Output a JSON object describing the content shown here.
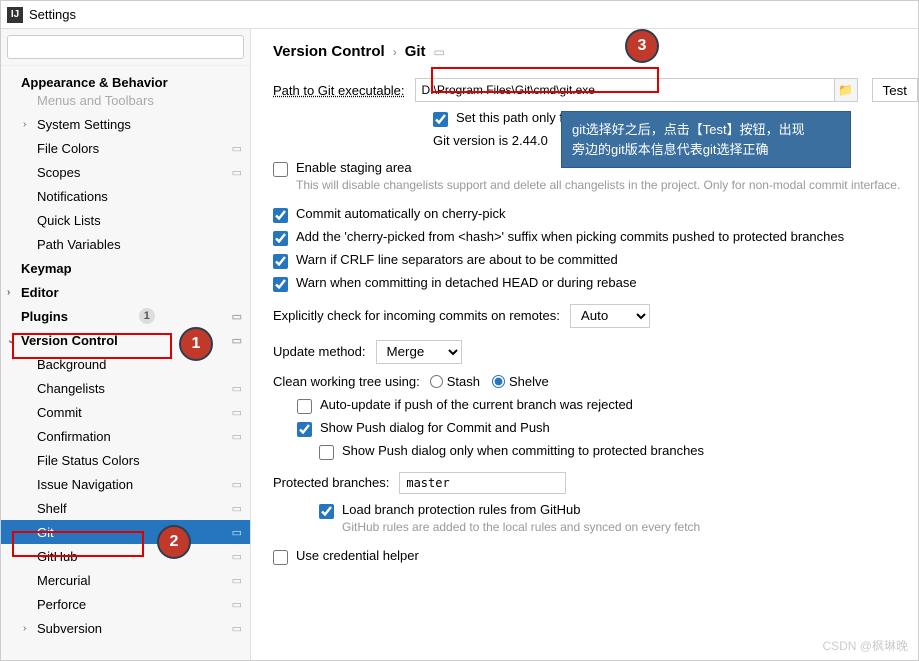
{
  "title": "Settings",
  "search_placeholder": "",
  "tree": {
    "appearance": "Appearance & Behavior",
    "menus": "Menus and Toolbars",
    "system_settings": "System Settings",
    "file_colors": "File Colors",
    "scopes": "Scopes",
    "notifications": "Notifications",
    "quick_lists": "Quick Lists",
    "path_vars": "Path Variables",
    "keymap": "Keymap",
    "editor": "Editor",
    "plugins": "Plugins",
    "plugins_badge": "1",
    "version_control": "Version Control",
    "background": "Background",
    "changelists": "Changelists",
    "commit": "Commit",
    "confirmation": "Confirmation",
    "file_status": "File Status Colors",
    "issue_nav": "Issue Navigation",
    "shelf": "Shelf",
    "git": "Git",
    "github": "GitHub",
    "mercurial": "Mercurial",
    "perforce": "Perforce",
    "subversion": "Subversion"
  },
  "breadcrumb": {
    "root": "Version Control",
    "leaf": "Git"
  },
  "form": {
    "path_label": "Path to Git executable:",
    "path_value": "D:\\Program Files\\Git\\cmd\\git.exe",
    "test_btn": "Test",
    "set_path_current": "Set this path only for the current project",
    "git_version": "Git version is 2.44.0",
    "staging_area": "Enable staging area",
    "staging_hint": "This will disable changelists support and delete all changelists in the project. Only for non-modal commit interface.",
    "cherry_auto": "Commit automatically on cherry-pick",
    "cherry_suffix": "Add the 'cherry-picked from <hash>' suffix when picking commits pushed to protected branches",
    "warn_crlf": "Warn if CRLF line separators are about to be committed",
    "warn_detached": "Warn when committing in detached HEAD or during rebase",
    "explicit_check": "Explicitly check for incoming commits on remotes:",
    "explicit_value": "Auto",
    "update_method": "Update method:",
    "update_value": "Merge",
    "clean_tree": "Clean working tree using:",
    "radio_stash": "Stash",
    "radio_shelve": "Shelve",
    "auto_update": "Auto-update if push of the current branch was rejected",
    "show_push": "Show Push dialog for Commit and Push",
    "show_push_protected": "Show Push dialog only when committing to protected branches",
    "protected_label": "Protected branches:",
    "protected_value": "master",
    "load_rules": "Load branch protection rules from GitHub",
    "load_rules_hint": "GitHub rules are added to the local rules and synced on every fetch",
    "cred_helper": "Use credential helper"
  },
  "annotations": {
    "tooltip_l1": "git选择好之后，点击【Test】按钮，出现",
    "tooltip_l2": "旁边的git版本信息代表git选择正确",
    "n1": "1",
    "n2": "2",
    "n3": "3"
  },
  "watermark": "CSDN @枫琳晚"
}
